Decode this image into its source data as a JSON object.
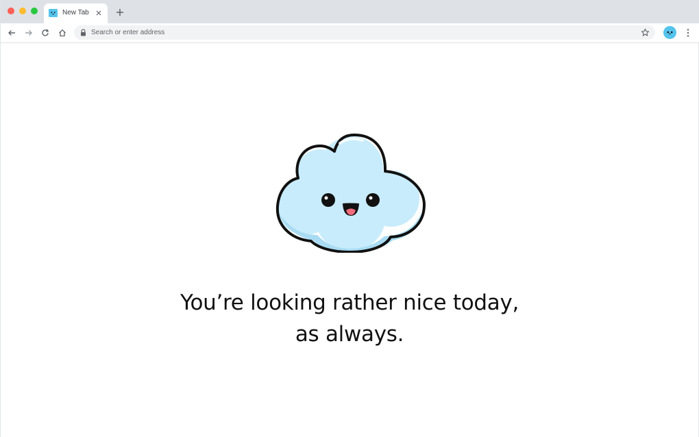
{
  "tab": {
    "title": "New Tab",
    "favicon": "cloud-favicon-icon",
    "close_icon": "close-icon"
  },
  "toolbar": {
    "address_placeholder": "Search or enter address",
    "icons": [
      "back-arrow-icon",
      "forward-arrow-icon",
      "reload-icon",
      "home-icon",
      "lock-icon",
      "star-icon",
      "menu-dots-icon"
    ]
  },
  "main": {
    "greeting_line1": "You’re looking rather nice today,",
    "greeting_line2": "as always.",
    "mascot": "smiling-cloud-icon"
  },
  "colors": {
    "cloud_light": "#c8ecfb",
    "cloud_shade": "#a9dcf3",
    "outline": "#111111",
    "tongue": "#f06b7b",
    "avatar": "#55c4ec"
  }
}
